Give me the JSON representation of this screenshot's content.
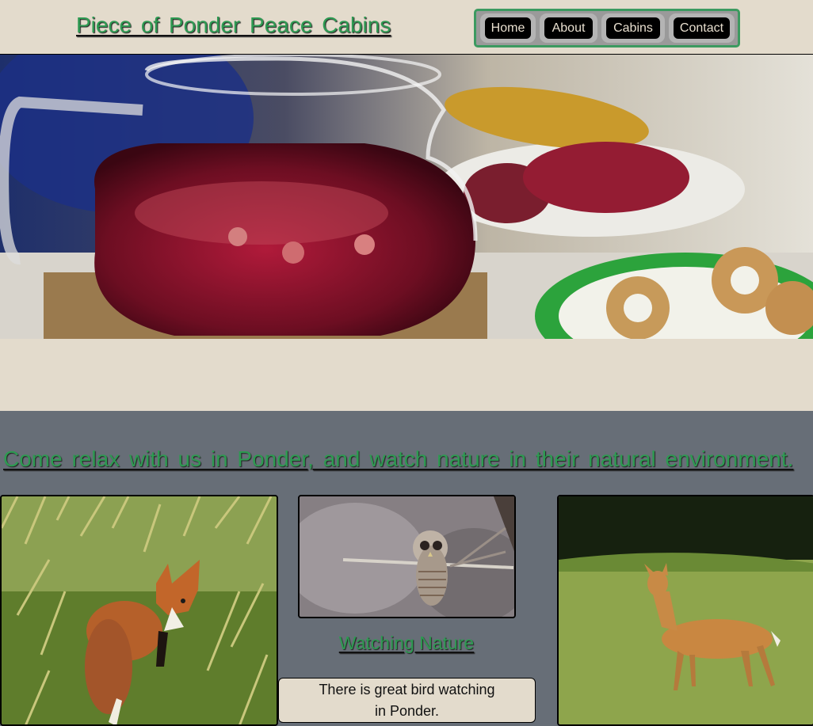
{
  "header": {
    "title": "Piece of Ponder Peace Cabins"
  },
  "nav": {
    "items": [
      "Home",
      "About",
      "Cabins",
      "Contact"
    ]
  },
  "main": {
    "tagline": "Come relax with us in Ponder, and watch nature in their natural environment.",
    "section_title": "Watching Nature",
    "description": "There is great bird watching in Ponder."
  },
  "colors": {
    "accent": "#2e9a52",
    "beige": "#e3dbcc",
    "slate": "#676e77"
  }
}
